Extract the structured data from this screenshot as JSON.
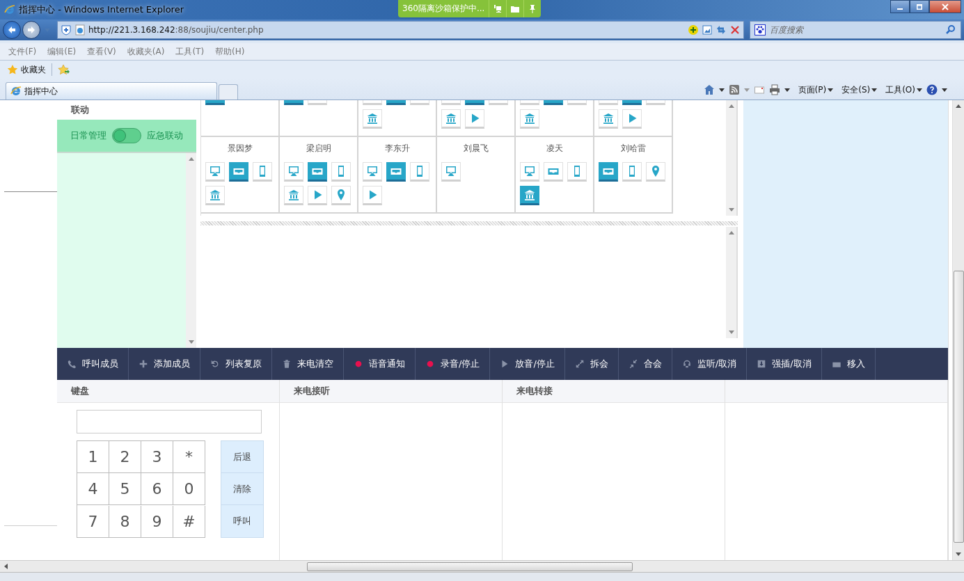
{
  "window": {
    "title": "指挥中心 - Windows Internet Explorer"
  },
  "sandbox_badge": {
    "text": "360隔离沙箱保护中..."
  },
  "address_bar": {
    "url_host": "http://221.3.168.242",
    "url_rest": ":88/soujiu/center.php"
  },
  "search": {
    "placeholder": "百度搜索"
  },
  "menu": [
    "文件(F)",
    "编辑(E)",
    "查看(V)",
    "收藏夹(A)",
    "工具(T)",
    "帮助(H)"
  ],
  "favorites_bar": {
    "label": "收藏夹"
  },
  "tabs": [
    {
      "label": "指挥中心",
      "selected": true
    }
  ],
  "command_bar": [
    "页面(P)",
    "安全(S)",
    "工具(O)"
  ],
  "sidebar": {
    "heading": "联动",
    "toggle": {
      "left_label": "日常管理",
      "right_label": "应急联动",
      "on": false
    }
  },
  "members": [
    {
      "icons": [
        {
          "kind": "cut",
          "selected": true
        }
      ]
    },
    {
      "icons": [
        {
          "kind": "cut",
          "selected": true
        },
        {
          "kind": "cut",
          "selected": false
        }
      ]
    },
    {
      "icons": [
        {
          "kind": "cut",
          "selected": false
        },
        {
          "kind": "cut",
          "selected": true
        },
        {
          "kind": "cut",
          "selected": false
        },
        {
          "kind": "bank",
          "selected": false
        }
      ]
    },
    {
      "icons": [
        {
          "kind": "cut",
          "selected": false
        },
        {
          "kind": "cut",
          "selected": true
        },
        {
          "kind": "cut",
          "selected": false
        },
        {
          "kind": "bank",
          "selected": false
        },
        {
          "kind": "play",
          "selected": false
        }
      ]
    },
    {
      "icons": [
        {
          "kind": "cut",
          "selected": false
        },
        {
          "kind": "cut",
          "selected": true
        },
        {
          "kind": "cut",
          "selected": false
        },
        {
          "kind": "bank",
          "selected": false
        }
      ]
    },
    {
      "icons": [
        {
          "kind": "cut",
          "selected": false
        },
        {
          "kind": "cut",
          "selected": true
        },
        {
          "kind": "cut",
          "selected": false
        },
        {
          "kind": "bank",
          "selected": false
        },
        {
          "kind": "play",
          "selected": false
        }
      ]
    },
    {
      "name": "景因梦",
      "icons": [
        {
          "kind": "screen",
          "selected": false
        },
        {
          "kind": "inbox",
          "selected": true
        },
        {
          "kind": "phone",
          "selected": false
        },
        {
          "kind": "bank",
          "selected": false
        }
      ]
    },
    {
      "name": "梁启明",
      "icons": [
        {
          "kind": "screen",
          "selected": false
        },
        {
          "kind": "inbox",
          "selected": true
        },
        {
          "kind": "phone",
          "selected": false
        },
        {
          "kind": "bank",
          "selected": false
        },
        {
          "kind": "play",
          "selected": false
        },
        {
          "kind": "pin",
          "selected": false
        }
      ]
    },
    {
      "name": "李东升",
      "icons": [
        {
          "kind": "screen",
          "selected": false
        },
        {
          "kind": "inbox",
          "selected": true
        },
        {
          "kind": "phone",
          "selected": false
        },
        {
          "kind": "play",
          "selected": false
        }
      ]
    },
    {
      "name": "刘晨飞",
      "icons": [
        {
          "kind": "screen",
          "selected": false
        }
      ]
    },
    {
      "name": "凌天",
      "icons": [
        {
          "kind": "screen",
          "selected": false
        },
        {
          "kind": "inbox",
          "selected": false
        },
        {
          "kind": "phone",
          "selected": false
        },
        {
          "kind": "bank",
          "selected": true
        }
      ]
    },
    {
      "name": "刘哈雷",
      "icons": [
        {
          "kind": "inbox",
          "selected": true
        },
        {
          "kind": "phone",
          "selected": false
        },
        {
          "kind": "pin",
          "selected": false
        }
      ]
    }
  ],
  "toolbar": [
    {
      "label": "呼叫成员",
      "kind": "phone"
    },
    {
      "label": "添加成员",
      "kind": "plus"
    },
    {
      "label": "列表复原",
      "kind": "undo"
    },
    {
      "label": "来电清空",
      "kind": "trash"
    },
    {
      "label": "语音通知",
      "kind": "dot"
    },
    {
      "label": "录音/停止",
      "kind": "dot"
    },
    {
      "label": "放音/停止",
      "kind": "play"
    },
    {
      "label": "拆会",
      "kind": "expand"
    },
    {
      "label": "合会",
      "kind": "collapse"
    },
    {
      "label": "监听/取消",
      "kind": "headset"
    },
    {
      "label": "强插/取消",
      "kind": "download"
    },
    {
      "label": "移入",
      "kind": "window"
    }
  ],
  "panels": [
    {
      "heading": "键盘"
    },
    {
      "heading": "来电接听"
    },
    {
      "heading": "来电转接"
    }
  ],
  "keypad": {
    "keys": [
      "1",
      "2",
      "3",
      "*",
      "4",
      "5",
      "6",
      "0",
      "7",
      "8",
      "9",
      "#"
    ],
    "actions": [
      "后退",
      "清除",
      "呼叫"
    ]
  }
}
